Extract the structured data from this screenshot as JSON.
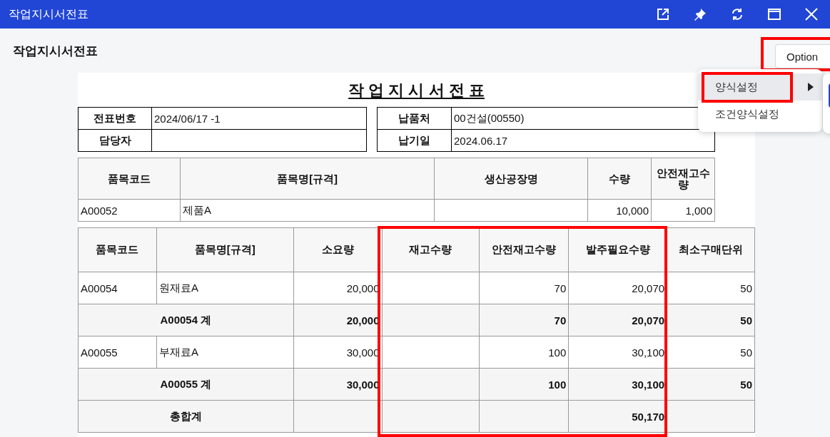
{
  "window": {
    "title": "작업지시서전표"
  },
  "page": {
    "heading": "작업지시서전표",
    "option_button": {
      "label": "Option",
      "highlighted": true
    }
  },
  "menu": {
    "items": [
      {
        "label": "양식설정",
        "selected": true,
        "has_submenu": true,
        "highlighted": true
      },
      {
        "label": "조건양식설정",
        "selected": false,
        "has_submenu": false,
        "highlighted": false
      }
    ]
  },
  "document": {
    "title": "작 업 지 시 서 전 표",
    "header_left": [
      {
        "label": "전표번호",
        "value": "2024/06/17 -1"
      },
      {
        "label": "담당자"
      }
    ],
    "header_right": [
      {
        "label": "납품처",
        "value": "00건설(00550)"
      },
      {
        "label": "납기일",
        "value": "2024.06.17"
      }
    ],
    "product_table": {
      "columns": [
        "품목코드",
        "품목명[규격]",
        "생산공장명",
        "수량",
        "안전재고수량"
      ],
      "rows": [
        [
          "A00052",
          "제품A",
          null,
          "10,000",
          "1,000"
        ]
      ]
    },
    "materials_table": {
      "columns": [
        {
          "label": "품목코드",
          "highlighted": false
        },
        {
          "label": "품목명[규격]",
          "highlighted": false
        },
        {
          "label": "소요량",
          "highlighted": false
        },
        {
          "label": "재고수량",
          "highlighted": true
        },
        {
          "label": "안전재고수량",
          "highlighted": true
        },
        {
          "label": "발주필요수량",
          "highlighted": true
        },
        {
          "label": "최소구매단위",
          "highlighted": false
        }
      ],
      "rows": [
        {
          "kind": "item",
          "cells": [
            "A00054",
            "원재료A",
            "20,000",
            null,
            "70",
            "20,070",
            "50"
          ]
        },
        {
          "kind": "subtotal",
          "label": "A00054 계",
          "cells": [
            "20,000",
            null,
            "70",
            "20,070",
            "50"
          ]
        },
        {
          "kind": "item",
          "cells": [
            "A00055",
            "부재료A",
            "30,000",
            null,
            "100",
            "30,100",
            "50"
          ]
        },
        {
          "kind": "subtotal",
          "label": "A00055 계",
          "cells": [
            "30,000",
            null,
            "100",
            "30,100",
            "50"
          ]
        },
        {
          "kind": "total",
          "label": "총합계",
          "cells": [
            null,
            null,
            null,
            "50,170",
            null
          ]
        }
      ]
    }
  }
}
